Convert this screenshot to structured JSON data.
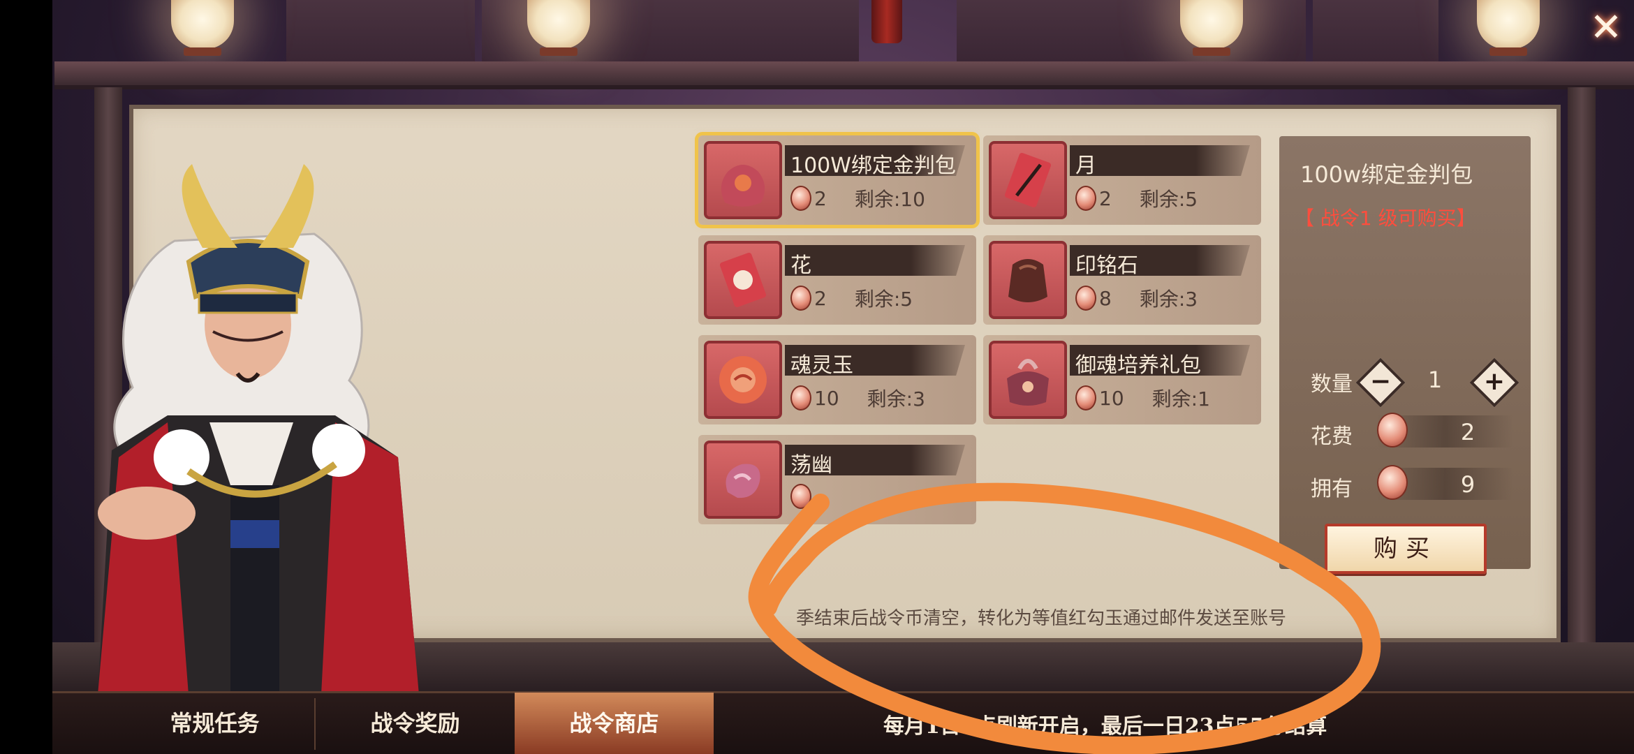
{
  "colors": {
    "accent_gold": "#f0c34a",
    "requirement_red": "#ff4d3d",
    "annotation_orange": "#f28a3c",
    "parchment": "#ddd0bb"
  },
  "shop": {
    "items": [
      {
        "name": "100W绑定金判包",
        "cost": "2",
        "stock": "剩余:10",
        "icon": "coin-bag-icon",
        "selected": true
      },
      {
        "name": "月",
        "cost": "2",
        "stock": "剩余:5",
        "icon": "moon-card-icon",
        "selected": false
      },
      {
        "name": "花",
        "cost": "2",
        "stock": "剩余:5",
        "icon": "flower-card-icon",
        "selected": false
      },
      {
        "name": "印铭石",
        "cost": "8",
        "stock": "剩余:3",
        "icon": "seal-stone-icon",
        "selected": false
      },
      {
        "name": "魂灵玉",
        "cost": "10",
        "stock": "剩余:3",
        "icon": "soul-jade-icon",
        "selected": false
      },
      {
        "name": "御魂培养礼包",
        "cost": "10",
        "stock": "剩余:1",
        "icon": "gift-pack-icon",
        "selected": false
      },
      {
        "name": "荡幽",
        "icon": "spirit-cloud-icon",
        "selected": false
      }
    ]
  },
  "detail": {
    "title": "100w绑定金判包",
    "requirement": "【 战令1 级可购买】",
    "quantity_label": "数量",
    "quantity": "1",
    "cost_label": "花费",
    "cost": "2",
    "owned_label": "拥有",
    "owned": "9",
    "buy_label": "购买"
  },
  "note": "季结束后战令币清空，转化为等值红勾玉通过邮件发送至账号",
  "tabs": [
    {
      "label": "常规任务",
      "active": false
    },
    {
      "label": "战令奖励",
      "active": false
    },
    {
      "label": "战令商店",
      "active": true
    }
  ],
  "refresh_note": "每月1日6点刷新开启，最后一日23点55分结算"
}
